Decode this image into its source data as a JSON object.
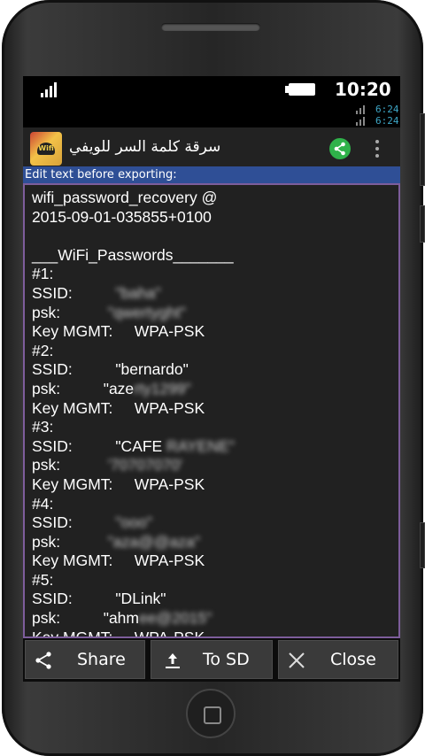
{
  "statusbar": {
    "time": "10:20"
  },
  "notification": {
    "time1": "6:24",
    "time2": "6:24"
  },
  "appbar": {
    "title": "سرقة كلمة السر للويفي",
    "icon_label": "Wifi"
  },
  "hint": "Edit text before exporting:",
  "export": {
    "header_line1": "wifi_password_recovery @",
    "header_line2": "2015-09-01-035855+0100",
    "section_title": "___WiFi_Passwords_______",
    "entries": [
      {
        "index": "#1:",
        "ssid_label": "SSID:",
        "ssid": "\"baha\"",
        "psk_label": "psk:",
        "psk": "\"qwertyght\"",
        "mgmt_label": "Key MGMT:",
        "mgmt": "WPA-PSK"
      },
      {
        "index": "#2:",
        "ssid_label": "SSID:",
        "ssid": "\"bernardo\"",
        "psk_label": "psk:",
        "psk_visible": "\"aze",
        "psk_hidden": "rty1299\"",
        "mgmt_label": "Key MGMT:",
        "mgmt": "WPA-PSK"
      },
      {
        "index": "#3:",
        "ssid_label": "SSID:",
        "ssid_visible": "\"CAFE",
        "ssid_hidden": "RAYENE\"",
        "psk_label": "psk:",
        "psk": "'70707070'",
        "mgmt_label": "Key MGMT:",
        "mgmt": "WPA-PSK"
      },
      {
        "index": "#4:",
        "ssid_label": "SSID:",
        "ssid": "\"ooo\"",
        "psk_label": "psk:",
        "psk": "\"aza@@aza\"",
        "mgmt_label": "Key MGMT:",
        "mgmt": "WPA-PSK"
      },
      {
        "index": "#5:",
        "ssid_label": "SSID:",
        "ssid": "\"DLink\"",
        "psk_label": "psk:",
        "psk_visible": "\"ahm",
        "psk_hidden": "ee@2015\"",
        "mgmt_label": "Key MGMT:",
        "mgmt": "WPA-PSK"
      }
    ]
  },
  "buttons": {
    "share": "Share",
    "to_sd": "To SD",
    "close": "Close"
  }
}
